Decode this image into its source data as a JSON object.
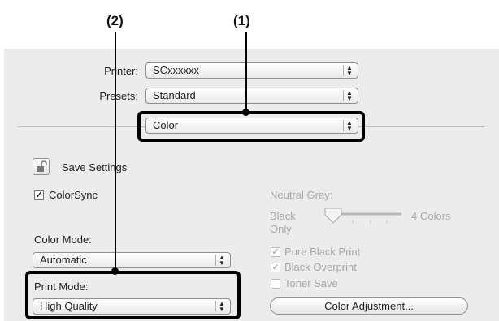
{
  "callouts": {
    "c1": "(1)",
    "c2": "(2)"
  },
  "printer": {
    "label": "Printer:",
    "value": "SCxxxxxx"
  },
  "presets": {
    "label": "Presets:",
    "value": "Standard"
  },
  "panel_menu": {
    "value": "Color"
  },
  "save_settings": {
    "label": "Save Settings",
    "icon": "lock-icon"
  },
  "colorsync": {
    "label": "ColorSync",
    "checked": true
  },
  "color_mode": {
    "label": "Color Mode:",
    "value": "Automatic"
  },
  "print_mode": {
    "label": "Print Mode:",
    "value": "High Quality"
  },
  "neutral_gray": {
    "label": "Neutral Gray:",
    "left_label": "Black Only",
    "right_label": "4 Colors"
  },
  "options": {
    "pure_black": "Pure Black Print",
    "black_overprint": "Black Overprint",
    "toner_save": "Toner Save"
  },
  "color_adjustment_button": "Color Adjustment..."
}
